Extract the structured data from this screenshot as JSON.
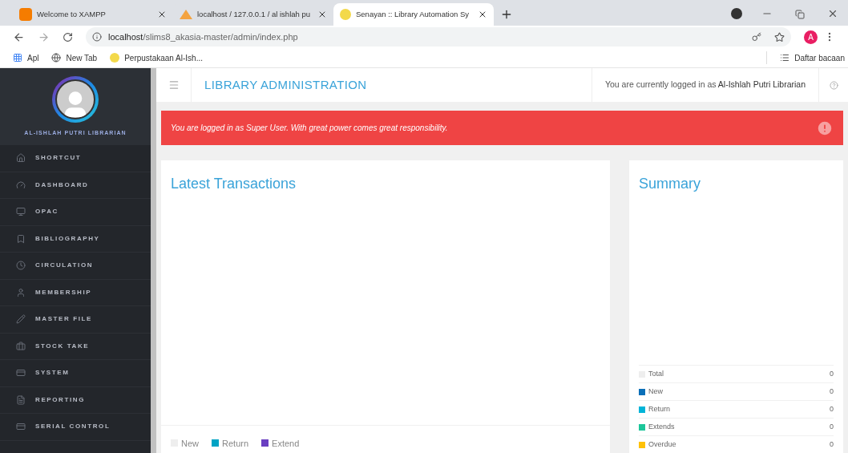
{
  "browser": {
    "tabs": [
      {
        "title": "Welcome to XAMPP",
        "selected": false
      },
      {
        "title": "localhost / 127.0.0.1 / al ishlah pu",
        "selected": false
      },
      {
        "title": "Senayan :: Library Automation Sy",
        "selected": true
      }
    ],
    "url_host": "localhost",
    "url_path": "/slims8_akasia-master/admin/index.php",
    "profile_initial": "A",
    "bookmarks": [
      "Apl",
      "New Tab",
      "Perpustakaan Al-Ish..."
    ],
    "reading_list": "Daftar bacaan"
  },
  "sidebar": {
    "user_name": "AL-ISHLAH PUTRI LIBRARIAN",
    "items": [
      {
        "label": "SHORTCUT"
      },
      {
        "label": "DASHBOARD"
      },
      {
        "label": "OPAC"
      },
      {
        "label": "BIBLIOGRAPHY"
      },
      {
        "label": "CIRCULATION"
      },
      {
        "label": "MEMBERSHIP"
      },
      {
        "label": "MASTER FILE"
      },
      {
        "label": "STOCK TAKE"
      },
      {
        "label": "SYSTEM"
      },
      {
        "label": "REPORTING"
      },
      {
        "label": "SERIAL CONTROL"
      }
    ]
  },
  "header": {
    "title": "LIBRARY ADMINISTRATION",
    "login_prefix": "You are currently logged in as ",
    "login_user": "Al-Ishlah Putri Librarian"
  },
  "alert": "You are logged in as Super User. With great power comes great responsibility.",
  "transactions": {
    "title": "Latest Transactions",
    "legend": [
      {
        "label": "New",
        "color": "#eeeeee"
      },
      {
        "label": "Return",
        "color": "#00a3c4"
      },
      {
        "label": "Extend",
        "color": "#6a3fc1"
      }
    ]
  },
  "summary": {
    "title": "Summary",
    "rows": [
      {
        "label": "Total",
        "value": "0",
        "color": "#eeeeee"
      },
      {
        "label": "New",
        "value": "0",
        "color": "#0a6fb8"
      },
      {
        "label": "Return",
        "value": "0",
        "color": "#00b4d8"
      },
      {
        "label": "Extends",
        "value": "0",
        "color": "#1cc69a"
      },
      {
        "label": "Overdue",
        "value": "0",
        "color": "#ffc107"
      }
    ]
  }
}
